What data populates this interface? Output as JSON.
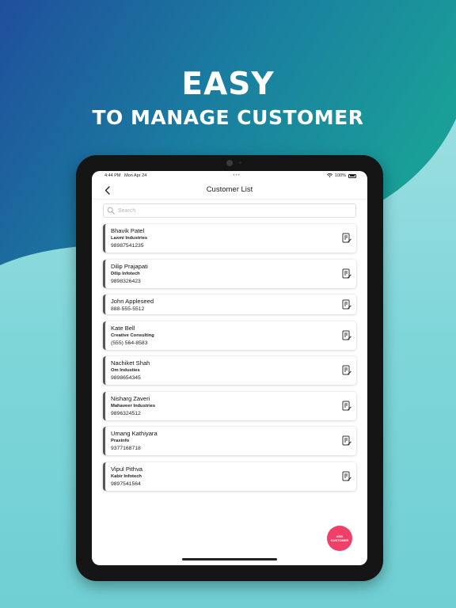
{
  "promo": {
    "headline": "EASY",
    "subheadline": "TO MANAGE CUSTOMER"
  },
  "colors": {
    "brand_blue": "#1e5aa0",
    "brand_teal": "#1a9496",
    "background": "#7fd6d9",
    "fab": "#f0406a",
    "card_accent": "#555555"
  },
  "status_bar": {
    "time": "4:44 PM",
    "date": "Mon Apr 24",
    "battery": "100%"
  },
  "nav": {
    "title": "Customer List",
    "back_icon": "chevron-left-icon"
  },
  "search": {
    "placeholder": "Search",
    "icon": "search-icon"
  },
  "customers": [
    {
      "name": "Bhavik Patel",
      "company": "Laxmi Industries",
      "phone": "98987541235"
    },
    {
      "name": "Dilip Prajapati",
      "company": "Dilip Infotech",
      "phone": "9898326423"
    },
    {
      "name": "John Appleseed",
      "company": "",
      "phone": "888-555-5512"
    },
    {
      "name": "Kate Bell",
      "company": "Creative Consulting",
      "phone": "(555) 564-8583"
    },
    {
      "name": "Nachiket Shah",
      "company": "Om Industies",
      "phone": "9898654345"
    },
    {
      "name": "Nisharg Zaveri",
      "company": "Mahaveer Industries",
      "phone": "9896324512"
    },
    {
      "name": "Umang Kathiyara",
      "company": "Praxinfo",
      "phone": "9377168718"
    },
    {
      "name": "Vipul Pithva",
      "company": "Kabir Infotech",
      "phone": "9897541564"
    }
  ],
  "fab": {
    "line1": "ADD",
    "line2": "CUSTOMER"
  }
}
